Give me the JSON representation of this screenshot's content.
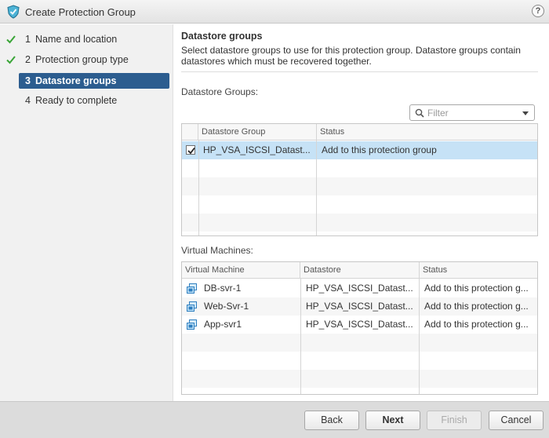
{
  "window": {
    "title": "Create Protection Group",
    "help_label": "?"
  },
  "steps": [
    {
      "num": "1",
      "label": "Name and location",
      "done": true
    },
    {
      "num": "2",
      "label": "Protection group type",
      "done": true
    },
    {
      "num": "3",
      "label": "Datastore groups",
      "active": true
    },
    {
      "num": "4",
      "label": "Ready to complete"
    }
  ],
  "content": {
    "title": "Datastore groups",
    "description": "Select datastore groups to use for this protection group. Datastore groups contain datastores which must be recovered together.",
    "datastore_groups_label": "Datastore Groups:",
    "filter_placeholder": "Filter",
    "vm_label": "Virtual Machines:"
  },
  "datastore_table": {
    "columns": [
      "Datastore Group",
      "Status"
    ],
    "rows": [
      {
        "checked": true,
        "group": "HP_VSA_ISCSI_Datast...",
        "status": "Add to this protection group"
      }
    ]
  },
  "vm_table": {
    "columns": [
      "Virtual Machine",
      "Datastore",
      "Status"
    ],
    "rows": [
      {
        "name": "DB-svr-1",
        "datastore": "HP_VSA_ISCSI_Datast...",
        "status": "Add to this protection g..."
      },
      {
        "name": "Web-Svr-1",
        "datastore": "HP_VSA_ISCSI_Datast...",
        "status": "Add to this protection g..."
      },
      {
        "name": "App-svr1",
        "datastore": "HP_VSA_ISCSI_Datast...",
        "status": "Add to this protection g..."
      }
    ]
  },
  "buttons": {
    "back": "Back",
    "next": "Next",
    "finish": "Finish",
    "cancel": "Cancel"
  },
  "colors": {
    "accent": "#2c5d8f",
    "selection": "#c6e2f6",
    "check_green": "#3aa537"
  }
}
